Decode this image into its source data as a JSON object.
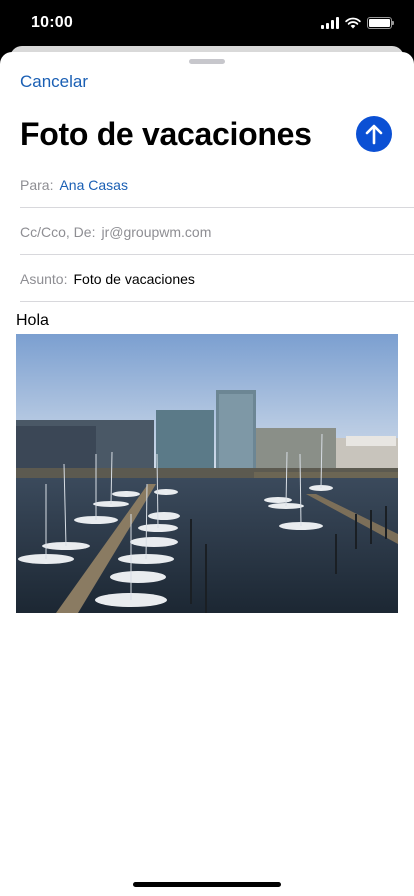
{
  "status": {
    "time": "10:00"
  },
  "compose": {
    "cancel_label": "Cancelar",
    "title": "Foto de vacaciones",
    "send_icon": "arrow-up-circle",
    "accent_color": "#0b50d4"
  },
  "fields": {
    "to": {
      "label": "Para:",
      "value": "Ana Casas"
    },
    "cc": {
      "label": "Cc/Cco, De:",
      "value": "jr@groupwm.com"
    },
    "subject": {
      "label": "Asunto:",
      "value": "Foto de vacaciones"
    }
  },
  "body": {
    "text": "Hola",
    "attachment": {
      "type": "image",
      "subject": "harbor-marina-photo"
    }
  }
}
